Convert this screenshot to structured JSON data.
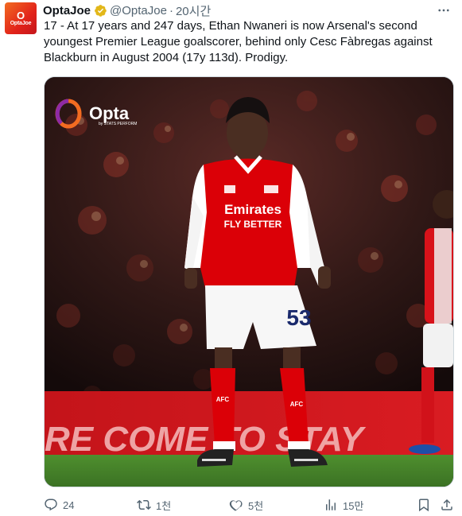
{
  "author": {
    "display_name": "OptaJoe",
    "handle": "@OptaJoe",
    "separator": "·",
    "time": "20시간",
    "avatar_text_big": "O",
    "avatar_text_small": "OptaJoe",
    "verified": true
  },
  "tweet": {
    "text": "17 - At 17 years and 247 days, Ethan Nwaneri is now Arsenal's second youngest Premier League goalscorer, behind only Cesc Fàbregas against Blackburn in August 2004 (17y 113d). Prodigy."
  },
  "media": {
    "watermark_brand": "Opta",
    "watermark_sub": "by STATS PERFORM",
    "sponsor_line1": "Emirates",
    "sponsor_line2": "FLY BETTER",
    "shirt_number": "53",
    "sock_text": "AFC",
    "banner_text": "RE COME TO STAY"
  },
  "actions": {
    "replies": "24",
    "reposts": "1천",
    "likes": "5천",
    "views": "15만"
  },
  "colors": {
    "text_primary": "#0f1419",
    "text_secondary": "#536471",
    "verified_gold": "#e2b719",
    "opta_orange": "#f26b21",
    "arsenal_red": "#db0007"
  }
}
